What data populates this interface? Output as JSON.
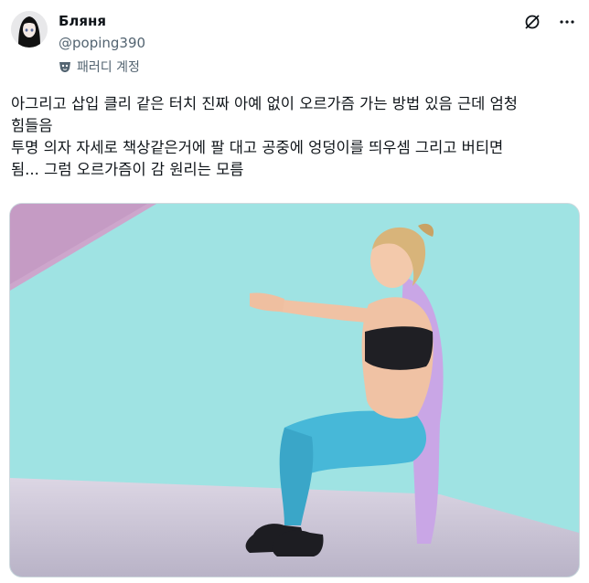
{
  "user": {
    "display_name": "Бляня",
    "handle": "@poping390",
    "label": "패러디 계정"
  },
  "icons": {
    "avatar": "anime-avatar",
    "label": "mask-icon",
    "grok": "grok-icon",
    "more": "more-icon"
  },
  "tweet": {
    "text": "아그리고 삽입 클리 같은 터치 진짜 아예 없이 오르가즘 가는 방법 있음 근데 엄청\n힘들음\n투명 의자 자세로 책상같은거에 팔 대고 공중에 엉덩이를 띄우셈 그리고 버티면\n됨... 그럼 오르가즘이 감 원리는 모름"
  },
  "colors": {
    "wall": "#9fe3e3",
    "accent_leggings": "#47b8d8",
    "shadow": "#c9a6e6"
  }
}
